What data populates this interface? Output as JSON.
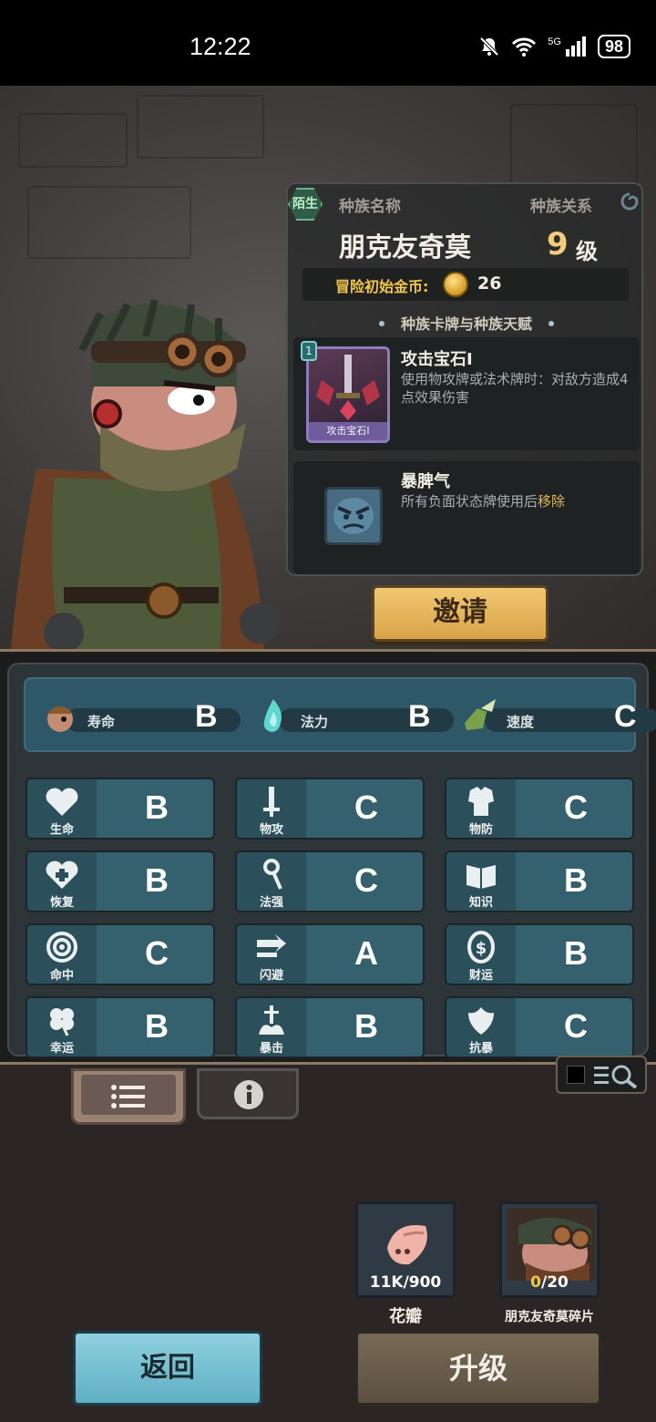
{
  "status_bar": {
    "time": "12:22",
    "network": "5G",
    "battery": "98"
  },
  "race": {
    "relation_badge": "陌生",
    "name_label": "种族名称",
    "relation_label": "种族关系",
    "name": "朋克友奇莫",
    "level": "9",
    "level_unit": "级",
    "gold_label": "冒险初始金币:",
    "gold_value": "26",
    "section_title": "种族卡牌与种族天赋",
    "card": {
      "title": "攻击宝石I",
      "desc": "使用物攻牌或法术牌时：对敌方造成4点效果伤害",
      "art_caption": "攻击宝石I",
      "cost": "1"
    },
    "talent": {
      "title": "暴脾气",
      "desc_prefix": "所有负面状态牌使用后",
      "desc_highlight": "移除"
    }
  },
  "invite_label": "邀请",
  "top_stats": [
    {
      "name": "寿命",
      "grade": "B",
      "icon": "acorn-icon"
    },
    {
      "name": "法力",
      "grade": "B",
      "icon": "blue-flame-icon"
    },
    {
      "name": "速度",
      "grade": "C",
      "icon": "winged-boot-icon"
    }
  ],
  "stats": [
    {
      "name": "生命",
      "grade": "B",
      "icon": "heart-icon"
    },
    {
      "name": "物攻",
      "grade": "C",
      "icon": "sword-icon"
    },
    {
      "name": "物防",
      "grade": "C",
      "icon": "armor-icon"
    },
    {
      "name": "恢复",
      "grade": "B",
      "icon": "heart-plus-icon"
    },
    {
      "name": "法强",
      "grade": "C",
      "icon": "staff-icon"
    },
    {
      "name": "知识",
      "grade": "B",
      "icon": "book-icon"
    },
    {
      "name": "命中",
      "grade": "C",
      "icon": "target-icon"
    },
    {
      "name": "闪避",
      "grade": "A",
      "icon": "dash-icon"
    },
    {
      "name": "财运",
      "grade": "B",
      "icon": "coin-icon"
    },
    {
      "name": "幸运",
      "grade": "B",
      "icon": "clover-icon"
    },
    {
      "name": "暴击",
      "grade": "B",
      "icon": "crit-icon"
    },
    {
      "name": "抗暴",
      "grade": "C",
      "icon": "shield-icon"
    }
  ],
  "materials": [
    {
      "label": "花瓣",
      "count": "11K/900"
    },
    {
      "label": "朋克友奇莫碎片",
      "count_owned": "0",
      "count_rest": "/20"
    }
  ],
  "back_label": "返回",
  "upgrade_label": "升级",
  "colors": {
    "accent_gold": "#f0c74a",
    "stat_teal": "#35616f",
    "back_blue": "#8ed0df"
  }
}
